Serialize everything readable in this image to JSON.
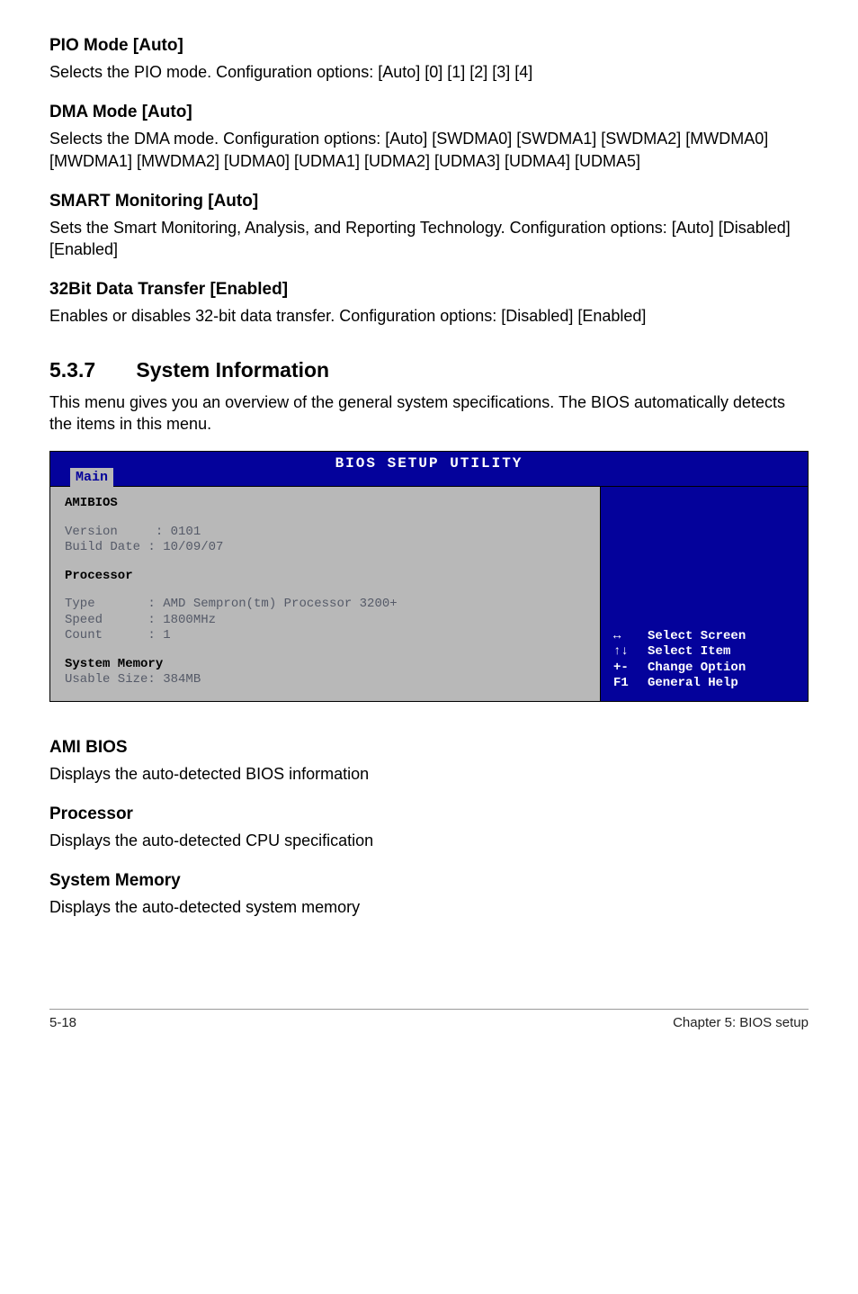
{
  "sections": {
    "pio": {
      "heading": "PIO Mode [Auto]",
      "text": "Selects the PIO mode. Configuration options: [Auto] [0] [1] [2] [3] [4]"
    },
    "dma": {
      "heading": "DMA Mode [Auto]",
      "text": "Selects the DMA mode. Configuration options: [Auto] [SWDMA0] [SWDMA1] [SWDMA2] [MWDMA0] [MWDMA1] [MWDMA2] [UDMA0] [UDMA1] [UDMA2] [UDMA3] [UDMA4] [UDMA5]"
    },
    "smart": {
      "heading": "SMART Monitoring [Auto]",
      "text": "Sets the Smart Monitoring, Analysis, and Reporting Technology. Configuration options: [Auto] [Disabled] [Enabled]"
    },
    "bit32": {
      "heading": "32Bit Data Transfer [Enabled]",
      "text": "Enables or disables 32-bit data transfer. Configuration options: [Disabled] [Enabled]"
    },
    "sysinfo": {
      "num": "5.3.7",
      "title": "System Information",
      "text": "This menu gives you an overview of the general system specifications. The BIOS automatically detects the items in this menu."
    },
    "amibios": {
      "heading": "AMI BIOS",
      "text": "Displays the auto-detected BIOS information"
    },
    "processor": {
      "heading": "Processor",
      "text": "Displays the auto-detected CPU specification"
    },
    "sysmem": {
      "heading": "System Memory",
      "text": "Displays the auto-detected system memory"
    }
  },
  "bios": {
    "title": "BIOS SETUP UTILITY",
    "tab": "Main",
    "left": {
      "heading1": "AMIBIOS",
      "version": "Version     : 0101",
      "builddate": "Build Date : 10/09/07",
      "heading2": "Processor",
      "type": "Type       : AMD Sempron(tm) Processor 3200+",
      "speed": "Speed      : 1800MHz",
      "count": "Count      : 1",
      "heading3": "System Memory",
      "usable": "Usable Size: 384MB"
    },
    "right": {
      "rows": [
        {
          "key": "↔",
          "label": "Select Screen"
        },
        {
          "key": "↑↓",
          "label": "Select Item"
        },
        {
          "key": "+-",
          "label": "Change Option"
        },
        {
          "key": "F1",
          "label": "General Help"
        }
      ]
    }
  },
  "footer": {
    "left": "5-18",
    "right": "Chapter 5: BIOS setup"
  }
}
